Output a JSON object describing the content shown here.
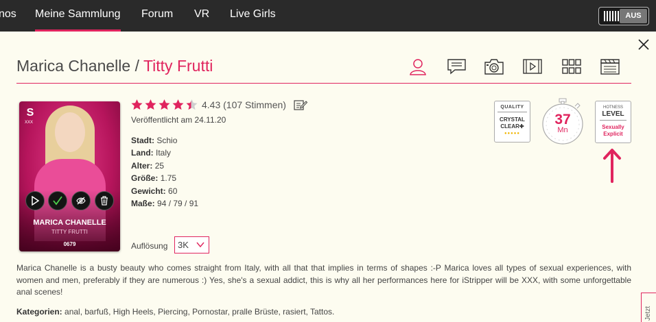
{
  "nav": {
    "items": [
      {
        "label": "nos",
        "active": false
      },
      {
        "label": "Meine Sammlung",
        "active": true
      },
      {
        "label": "Forum",
        "active": false
      },
      {
        "label": "VR",
        "active": false
      },
      {
        "label": "Live Girls",
        "active": false
      }
    ],
    "toggle_state": "AUS"
  },
  "header": {
    "model_name": "Marica Chanelle",
    "separator": " / ",
    "scene_name": "Titty Frutti"
  },
  "tabs": [
    {
      "icon": "profile-icon"
    },
    {
      "icon": "comments-icon"
    },
    {
      "icon": "camera-icon"
    },
    {
      "icon": "video-icon"
    },
    {
      "icon": "grid-icon"
    },
    {
      "icon": "clapperboard-icon"
    }
  ],
  "card": {
    "logo": "S",
    "logo_sub": "XXX",
    "name": "MARICA CHANELLE",
    "subtitle": "TITTY FRUTTI",
    "number": "0679"
  },
  "rating": {
    "stars": 4.43,
    "text": "4.43 (107 Stimmen)"
  },
  "published": "Veröffentlicht am 24.11.20",
  "attributes": [
    {
      "label": "Stadt:",
      "value": "Schio"
    },
    {
      "label": "Land:",
      "value": "Italy"
    },
    {
      "label": "Alter:",
      "value": "25"
    },
    {
      "label": "Größe:",
      "value": "1.75"
    },
    {
      "label": "Gewicht:",
      "value": "60"
    },
    {
      "label": "Maße:",
      "value": "94 / 79 / 91"
    }
  ],
  "resolution": {
    "label": "Auflösung",
    "selected": "3K"
  },
  "badges": {
    "quality_title": "QUALITY",
    "quality_line1": "CRYSTAL",
    "quality_line2": "CLEAR✚",
    "quality_dots": "●●●●●",
    "duration_value": "37",
    "duration_unit": "Mn",
    "hotness_title": "HOTNESS",
    "hotness_level": "LEVEL",
    "hotness_line1": "Sexually",
    "hotness_line2": "Explicit"
  },
  "description": "Marica Chanelle is a busty beauty who comes straight from Italy, with all that that implies in terms of shapes :-P Marica loves all types of sexual experiences, with women and men, preferably if they are numerous :) Yes, she's a sexual addict, this is why all her performances here for iStripper will be XXX, with some unforgettable anal scenes!",
  "categories": {
    "label": "Kategorien:",
    "value": "anal, barfuß, High Heels, Piercing, Pornostar, pralle Brüste, rasiert, Tattos."
  },
  "side_tab": "Jetzt",
  "colors": {
    "accent": "#e0245e",
    "nav_bg": "#2a2a2a",
    "page_bg": "#fdfcf0"
  }
}
